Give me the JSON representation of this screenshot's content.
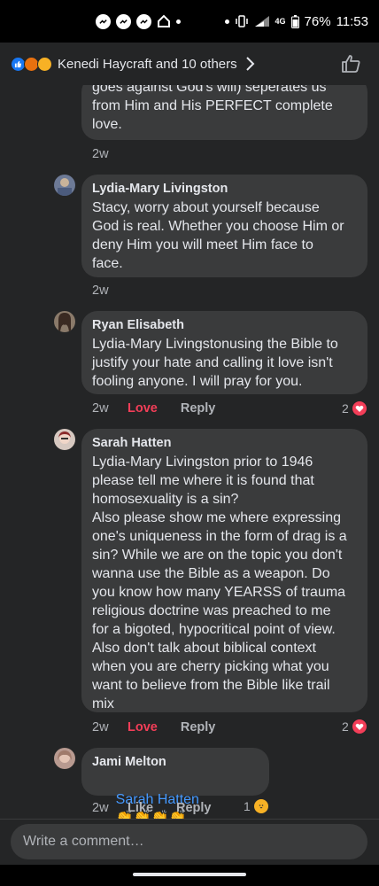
{
  "status_bar": {
    "battery": "76%",
    "time": "11:53",
    "network": "4G",
    "icons": [
      "messenger-icon",
      "messenger-icon",
      "messenger-icon",
      "home-icon"
    ]
  },
  "reactions": {
    "names": "Kenedi Haycraft and 10 others",
    "types": [
      "like",
      "angry",
      "haha"
    ]
  },
  "comments": [
    {
      "id": "partial",
      "text": "goes against God's will) seperates us\nfrom Him and His PERFECT complete\nlove.",
      "time": "2w"
    },
    {
      "id": "lydia",
      "name": "Lydia-Mary Livingston",
      "text": "Stacy, worry about yourself because\nGod is real. Whether you choose Him or\ndeny Him you will meet Him face to\nface.",
      "time": "2w"
    },
    {
      "id": "ryan",
      "name": "Ryan Elisabeth",
      "text": "Lydia-Mary Livingstonusing the Bible to\njustify your hate and calling it love isn't\nfooling anyone. I will pray for you.",
      "time": "2w",
      "reaction_label": "Love",
      "reply_label": "Reply",
      "reaction_count": "2"
    },
    {
      "id": "sarah",
      "name": "Sarah Hatten",
      "text": "Lydia-Mary Livingston prior to 1946\nplease tell me where it is found that\nhomosexuality is a sin?\nAlso please show me where expressing\none's uniqueness in the form of drag is a\nsin? While we are on the topic you don't\nwanna use the Bible as a weapon. Do\nyou know how many YEARSS of trauma\nreligious doctrine was preached to me\nfor a bigoted, hypocritical point of view.\nAlso don't talk about biblical context\nwhen you are cherry picking what you\nwant to believe from the Bible like trail\nmix",
      "time": "2w",
      "reaction_label": "Love",
      "reply_label": "Reply",
      "reaction_count": "2"
    },
    {
      "id": "jami",
      "name": "Jami Melton",
      "mention": "Sarah Hatten",
      "emoji": "👏👏👏👏",
      "time": "2w",
      "reaction_label": "Like",
      "reply_label": "Reply",
      "reaction_count": "1"
    }
  ],
  "composer": {
    "placeholder": "Write a comment…"
  },
  "colors": {
    "background": "#242526",
    "bubble": "#3a3b3c",
    "love": "#f33e58",
    "link": "#4599ff"
  }
}
